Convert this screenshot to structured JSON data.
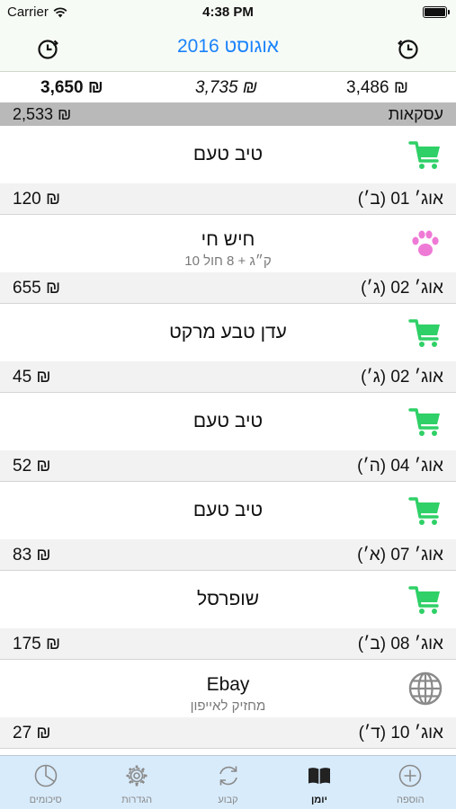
{
  "status": {
    "carrier": "Carrier",
    "time": "4:38 PM"
  },
  "nav": {
    "title": "אוגוסט 2016"
  },
  "totals": {
    "left": "3,650 ₪",
    "center": "3,735 ₪",
    "right": "3,486 ₪"
  },
  "section": {
    "amount": "2,533 ₪",
    "label": "עסקאות"
  },
  "entries": [
    {
      "name": "טיב טעם",
      "note": "",
      "amount": "120 ₪",
      "date": "אוג׳ 01 (ב׳)",
      "icon": "shopping-cart-icon"
    },
    {
      "name": "חיש חי",
      "note": "10 ק״ג + 8 חול",
      "amount": "655 ₪",
      "date": "אוג׳ 02 (ג׳)",
      "icon": "paw-icon"
    },
    {
      "name": "עדן טבע מרקט",
      "note": "",
      "amount": "45 ₪",
      "date": "אוג׳ 02 (ג׳)",
      "icon": "shopping-cart-icon"
    },
    {
      "name": "טיב טעם",
      "note": "",
      "amount": "52 ₪",
      "date": "אוג׳ 04 (ה׳)",
      "icon": "shopping-cart-icon"
    },
    {
      "name": "טיב טעם",
      "note": "",
      "amount": "83 ₪",
      "date": "אוג׳ 07 (א׳)",
      "icon": "shopping-cart-icon"
    },
    {
      "name": "שופרסל",
      "note": "",
      "amount": "175 ₪",
      "date": "אוג׳ 08 (ב׳)",
      "icon": "shopping-cart-icon"
    },
    {
      "name": "Ebay",
      "note": "מחזיק לאייפון",
      "amount": "27 ₪",
      "date": "אוג׳ 10 (ד׳)",
      "icon": "globe-icon"
    }
  ],
  "tabs": [
    {
      "label": "סיכומים",
      "icon": "pie-chart-icon",
      "active": false
    },
    {
      "label": "הגדרות",
      "icon": "gear-icon",
      "active": false
    },
    {
      "label": "קבוע",
      "icon": "recurring-icon",
      "active": false
    },
    {
      "label": "יומן",
      "icon": "book-icon",
      "active": true
    },
    {
      "label": "הוספה",
      "icon": "add-icon",
      "active": false
    }
  ],
  "colors": {
    "accent": "#1a82fb",
    "cart_green": "#2fd067",
    "paw_pink": "#ef7ad6",
    "tab_bar": "#d8ebfb",
    "section_gray": "#b9b9b9"
  }
}
